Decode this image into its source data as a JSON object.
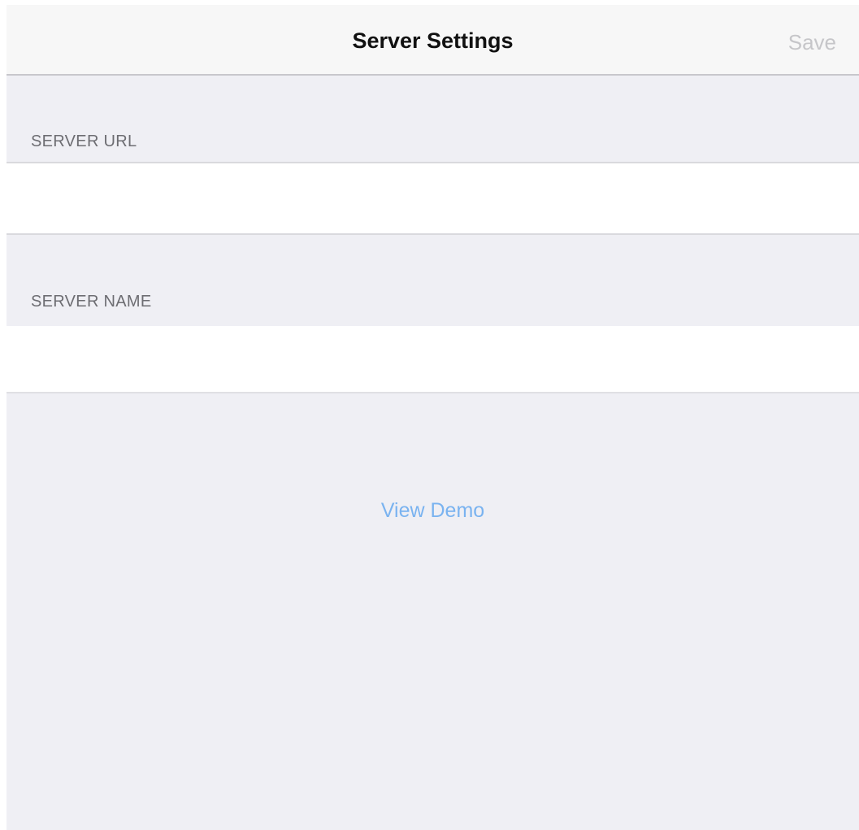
{
  "navbar": {
    "title": "Server Settings",
    "save_label": "Save"
  },
  "sections": {
    "server_url_header": "SERVER URL",
    "server_url_value": "",
    "server_name_header": "SERVER NAME",
    "server_name_value": ""
  },
  "footer": {
    "view_demo_label": "View Demo"
  },
  "colors": {
    "link": "#7ab3f0",
    "disabled_save": "#c6c6c9",
    "grouped_background": "#efeff4",
    "section_label": "#6d6d72"
  }
}
